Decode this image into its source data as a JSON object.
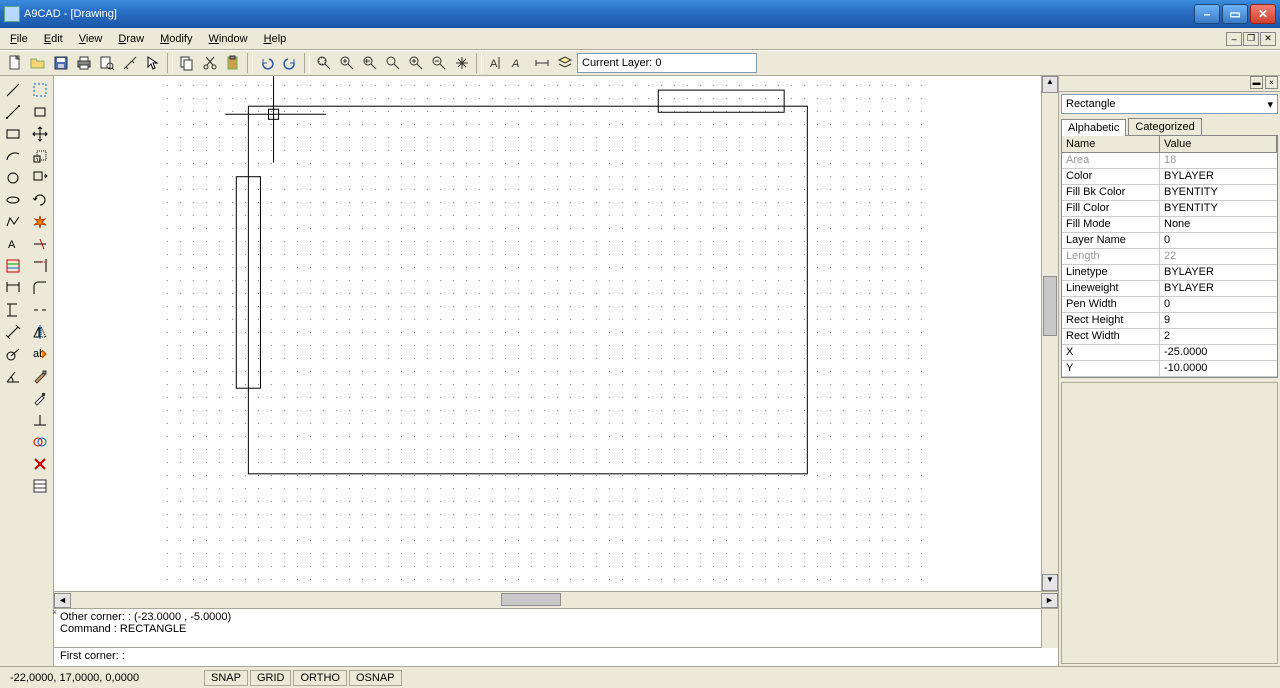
{
  "title": "A9CAD - [Drawing]",
  "menus": {
    "file": "File",
    "edit": "Edit",
    "view": "View",
    "draw": "Draw",
    "modify": "Modify",
    "window": "Window",
    "help": "Help"
  },
  "toolbar": {
    "layer_label": "Current Layer: 0"
  },
  "props": {
    "combo": "Rectangle",
    "tab_alpha": "Alphabetic",
    "tab_cat": "Categorized",
    "hdr_name": "Name",
    "hdr_value": "Value",
    "rows": [
      {
        "name": "Area",
        "value": "18",
        "dis": true
      },
      {
        "name": "Color",
        "value": "BYLAYER"
      },
      {
        "name": "Fill Bk Color",
        "value": "BYENTITY"
      },
      {
        "name": "Fill Color",
        "value": "BYENTITY"
      },
      {
        "name": "Fill Mode",
        "value": "None"
      },
      {
        "name": "Layer Name",
        "value": "0"
      },
      {
        "name": "Length",
        "value": "22",
        "dis": true
      },
      {
        "name": "Linetype",
        "value": "BYLAYER"
      },
      {
        "name": "Lineweight",
        "value": "BYLAYER"
      },
      {
        "name": "Pen Width",
        "value": "0"
      },
      {
        "name": "Rect Height",
        "value": "9"
      },
      {
        "name": "Rect Width",
        "value": "2"
      },
      {
        "name": "X",
        "value": "-25.0000"
      },
      {
        "name": "Y",
        "value": "-10.0000"
      }
    ]
  },
  "cmd": {
    "log1": "Other corner: : (-23.0000 , -5.0000)",
    "log2": "Command : RECTANGLE",
    "prompt": "First corner: :"
  },
  "status": {
    "coord": "-22,0000, 17,0000, 0,0000",
    "snap": "SNAP",
    "grid": "GRID",
    "ortho": "ORTHO",
    "osnap": "OSNAP"
  }
}
